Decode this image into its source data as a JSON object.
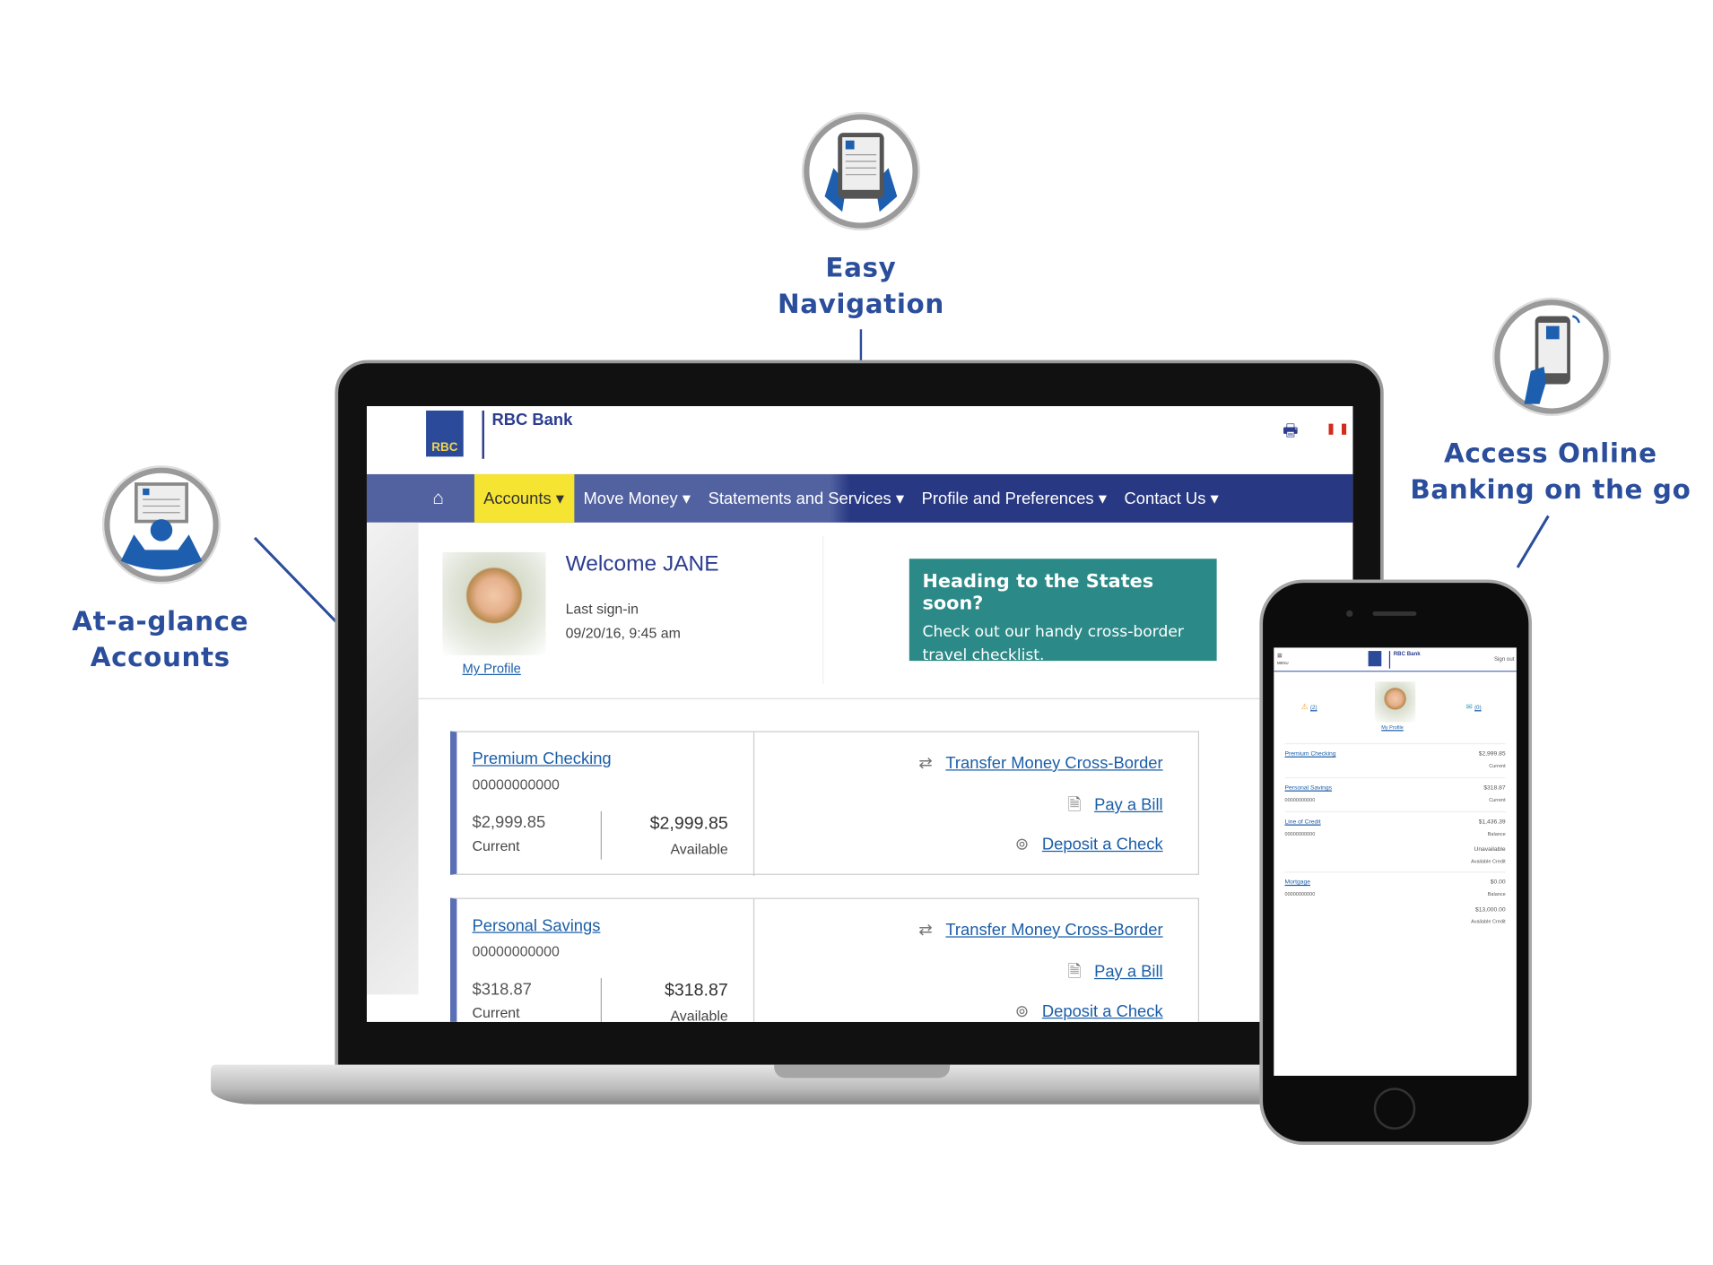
{
  "callouts": {
    "nav": [
      "Easy",
      "Navigation"
    ],
    "mobile": [
      "Access Online",
      "Banking on the go"
    ],
    "accounts": [
      "At-a-glance",
      "Accounts"
    ]
  },
  "colors": {
    "brand": "#2c3d8f",
    "accent_yellow": "#f5e431",
    "promo": "#2b8a87",
    "link": "#1b5ea8",
    "callout": "#2a4d9c"
  },
  "header": {
    "bank_name": "RBC Bank",
    "logo_text": "RBC",
    "print_icon": "printer-icon",
    "flag_icon": "canada-flag-icon"
  },
  "nav": {
    "home_icon": "home-icon",
    "items": [
      "Accounts",
      "Move Money",
      "Statements and Services",
      "Profile and Preferences",
      "Contact Us"
    ]
  },
  "welcome": {
    "title": "Welcome JANE",
    "last_signin_label": "Last sign-in",
    "last_signin": "09/20/16, 9:45 am",
    "profile_link": "My Profile"
  },
  "promo": {
    "heading": "Heading to the States soon?",
    "body": "Check out our handy cross-border travel checklist."
  },
  "accounts": [
    {
      "name": "Premium Checking",
      "number": "00000000000",
      "current": "$2,999.85",
      "current_label": "Current",
      "available": "$2,999.85",
      "available_label": "Available"
    },
    {
      "name": "Personal Savings",
      "number": "00000000000",
      "current": "$318.87",
      "current_label": "Current",
      "available": "$318.87",
      "available_label": "Available"
    }
  ],
  "actions": [
    "Transfer Money Cross-Border",
    "Pay a Bill",
    "Deposit a Check"
  ],
  "mobile": {
    "menu": "MENU",
    "bank_name": "RBC Bank",
    "sign_out": "Sign out",
    "alerts": "(2)",
    "messages": "(0)",
    "profile_link": "My Profile",
    "accounts": [
      {
        "name": "Premium Checking",
        "number": "",
        "lines": [
          [
            "$2,999.85",
            "Current"
          ]
        ]
      },
      {
        "name": "Personal Savings",
        "number": "00000000000",
        "lines": [
          [
            "$318.87",
            "Current"
          ]
        ]
      },
      {
        "name": "Line of Credit",
        "number": "00000000000",
        "lines": [
          [
            "$1,436.39",
            "Balance"
          ],
          [
            "Unavailable",
            "Available Credit"
          ]
        ]
      },
      {
        "name": "Mortgage",
        "number": "00000000000",
        "lines": [
          [
            "$0.00",
            "Balance"
          ],
          [
            "$13,000.00",
            "Available Credit"
          ]
        ]
      }
    ]
  }
}
